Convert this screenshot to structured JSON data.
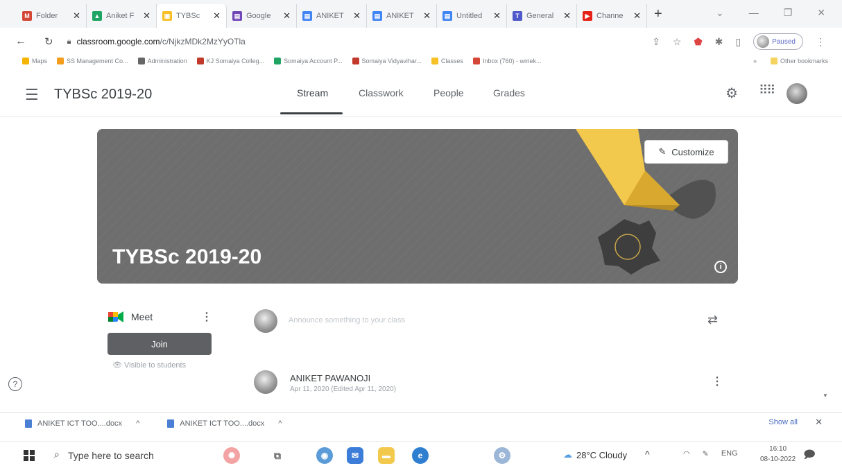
{
  "browser": {
    "tabs": [
      {
        "label": "Folder",
        "favicon": "gmail-icon",
        "color": "#d44638",
        "glyph": "M"
      },
      {
        "label": "Aniket F",
        "favicon": "drive-icon",
        "color": "#1fa463",
        "glyph": "▲"
      },
      {
        "label": "TYBSc",
        "favicon": "classroom-icon",
        "color": "#f6c026",
        "glyph": "▣"
      },
      {
        "label": "Google",
        "favicon": "forms-icon",
        "color": "#7248b9",
        "glyph": "▤"
      },
      {
        "label": "ANIKET",
        "favicon": "docs-icon",
        "color": "#4285f4",
        "glyph": "▤"
      },
      {
        "label": "ANIKET",
        "favicon": "docs-icon",
        "color": "#4285f4",
        "glyph": "▤"
      },
      {
        "label": "Untitled",
        "favicon": "docs-icon",
        "color": "#4285f4",
        "glyph": "▤"
      },
      {
        "label": "General",
        "favicon": "teams-icon",
        "color": "#5059c9",
        "glyph": "T"
      },
      {
        "label": "Channe",
        "favicon": "youtube-icon",
        "color": "#e62117",
        "glyph": "▶"
      }
    ],
    "new_tab": "+",
    "url_host": "classroom.google.com",
    "url_path": "/c/NjkzMDk2MzYyOTla",
    "paused_label": "Paused",
    "bookmarks": [
      {
        "label": "Maps",
        "color": "#f4b400"
      },
      {
        "label": "SS Management Co...",
        "color": "#f49c1b"
      },
      {
        "label": "Administration",
        "color": "#666666"
      },
      {
        "label": "KJ Somaiya Colleg...",
        "color": "#c0392b"
      },
      {
        "label": "Somaiya Account P...",
        "color": "#1fa463"
      },
      {
        "label": "Somaiya Vidyavihar...",
        "color": "#c0392b"
      },
      {
        "label": "Classes",
        "color": "#f6c026"
      },
      {
        "label": "Inbox (760) - wmek...",
        "color": "#d44638"
      }
    ],
    "bookmarks_more": "»",
    "other_bookmarks": "Other bookmarks"
  },
  "classroom": {
    "class_name": "TYBSc 2019-20",
    "nav_tabs": [
      "Stream",
      "Classwork",
      "People",
      "Grades"
    ],
    "active_tab": "Stream",
    "banner_title": "TYBSc 2019-20",
    "customize_label": "Customize",
    "meet": {
      "label": "Meet",
      "join_label": "Join",
      "visible_note": "Visible to students"
    },
    "announce_placeholder": "Announce something to your class",
    "post": {
      "author": "ANIKET PAWANOJI",
      "date": "Apr 11, 2020 (Edited Apr 11, 2020)"
    }
  },
  "downloads": {
    "items": [
      "ANIKET ICT TOO....docx",
      "ANIKET ICT TOO....docx"
    ],
    "show_all": "Show all"
  },
  "taskbar": {
    "search_placeholder": "Type here to search",
    "weather": "28°C  Cloudy",
    "lang": "ENG",
    "time": "16:10",
    "date": "08-10-2022"
  },
  "colors": {
    "banner_bg": "#6e6e6e",
    "join_bg": "#5f6063",
    "accent_yellow": "#f2c94c"
  }
}
